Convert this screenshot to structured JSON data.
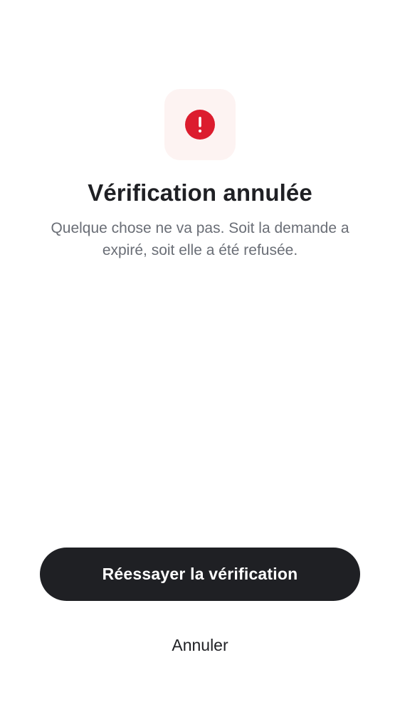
{
  "status": {
    "icon": "alert-circle-icon",
    "icon_color": "#dc1c2e",
    "tile_color": "#fdf3f2",
    "title": "Vérification annulée",
    "description": "Quelque chose ne va pas. Soit la demande a expiré, soit elle a été refusée."
  },
  "actions": {
    "retry_label": "Réessayer la vérification",
    "cancel_label": "Annuler"
  },
  "colors": {
    "primary_button": "#1f2024",
    "text_primary": "#1f2024",
    "text_secondary": "#6a6e76",
    "background": "#ffffff"
  }
}
